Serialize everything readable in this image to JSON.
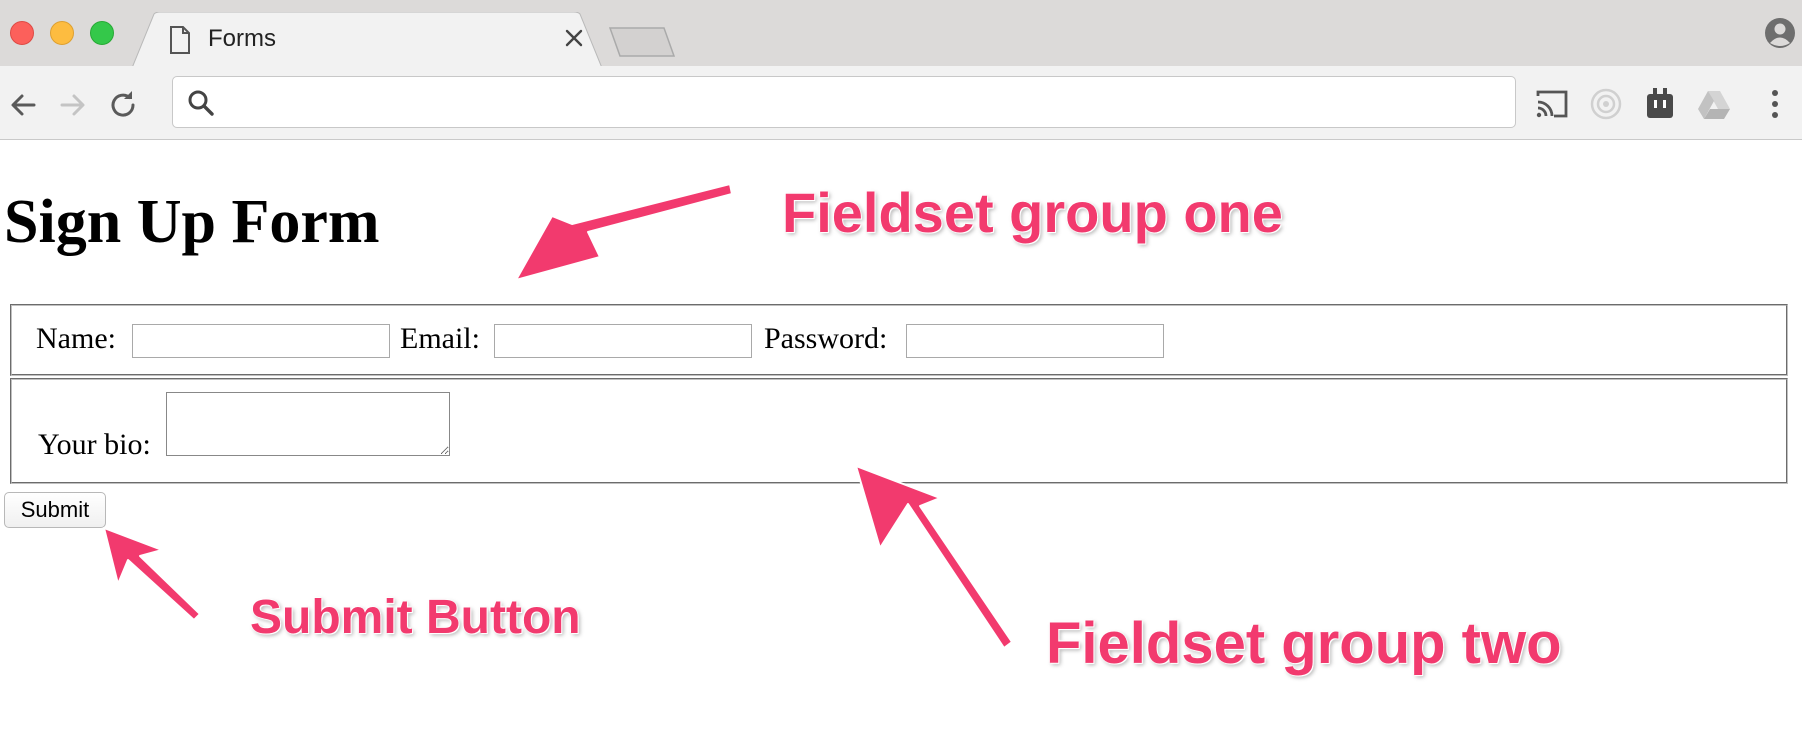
{
  "browser": {
    "tab_title": "Forms",
    "address_value": "",
    "address_placeholder": "",
    "icons": [
      "doc-icon",
      "close-icon",
      "back-icon",
      "forward-icon",
      "reload-icon",
      "search-icon",
      "cast-icon",
      "target-extension-icon",
      "plug-extension-icon",
      "drive-icon",
      "menu-icon",
      "profile-icon"
    ]
  },
  "page": {
    "title": "Sign Up Form",
    "fieldset_one": {
      "name_label": "Name:",
      "email_label": "Email:",
      "password_label": "Password:",
      "name_value": "",
      "email_value": "",
      "password_value": ""
    },
    "fieldset_two": {
      "bio_label": "Your bio:",
      "bio_value": ""
    },
    "submit_label": "Submit"
  },
  "annotations": {
    "fieldset_one": "Fieldset group one",
    "submit": "Submit Button",
    "fieldset_two": "Fieldset group two",
    "color": "#f23a6e"
  }
}
